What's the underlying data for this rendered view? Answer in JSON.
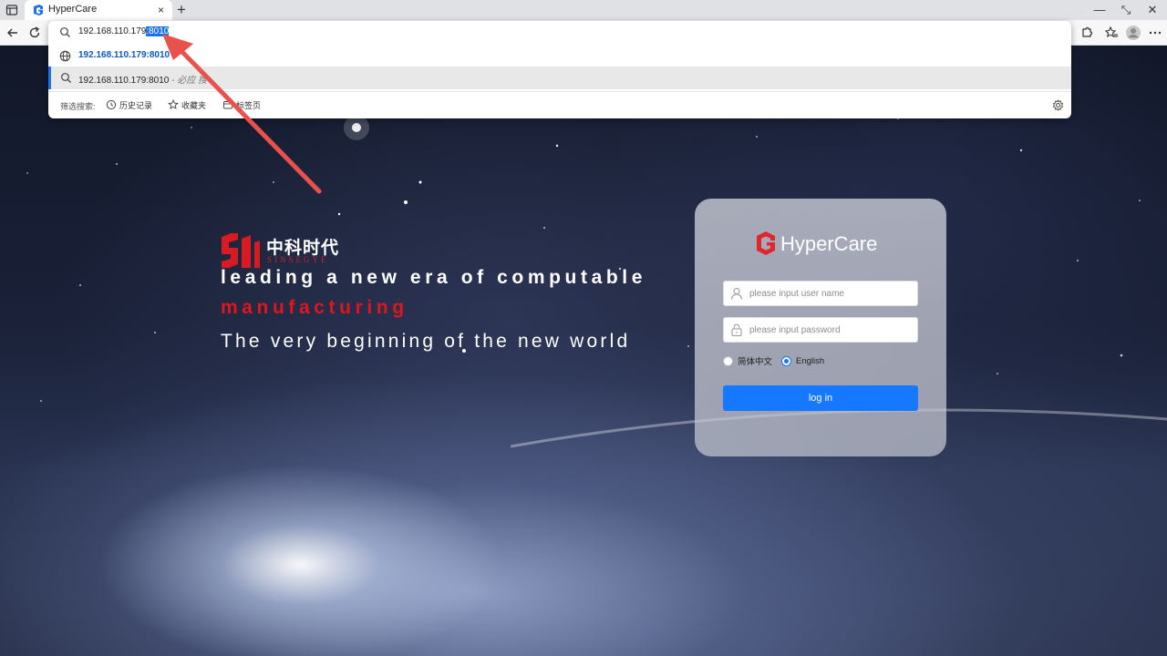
{
  "browser": {
    "tab": {
      "title": "HyperCare",
      "close_glyph": "×"
    },
    "new_tab_glyph": "+",
    "window_controls": {
      "minimize": "—",
      "restore": "⤡",
      "close": "✕"
    },
    "address_bar": {
      "url_plain": "192.168.110.179",
      "url_selected": ":8010"
    },
    "suggestions": [
      {
        "icon": "globe-icon",
        "text": "192.168.110.179:8010"
      },
      {
        "icon": "search-icon",
        "text": "192.168.110.179:8010",
        "suffix": " - 必应 搜"
      }
    ],
    "filter": {
      "label": "筛选搜索:",
      "chips": [
        {
          "icon": "history-icon",
          "label": "历史记录"
        },
        {
          "icon": "star-icon",
          "label": "收藏夹"
        },
        {
          "icon": "tabs-icon",
          "label": "标签页"
        }
      ]
    }
  },
  "brand": {
    "cn_name": "中科时代",
    "en_name": "SINSEGYE"
  },
  "slogan": {
    "line1": "leading a new era of computable",
    "line2": "manufacturing",
    "line3": "The very beginning of the new world"
  },
  "login": {
    "title": "HyperCare",
    "username_placeholder": "please input user name",
    "password_placeholder": "please input password",
    "languages": [
      {
        "label": "简体中文",
        "checked": false
      },
      {
        "label": "English",
        "checked": true
      }
    ],
    "submit_label": "log in"
  },
  "colors": {
    "accent_blue": "#1677ff",
    "brand_red": "#e0151d",
    "annotation_arrow": "#e8524a"
  }
}
